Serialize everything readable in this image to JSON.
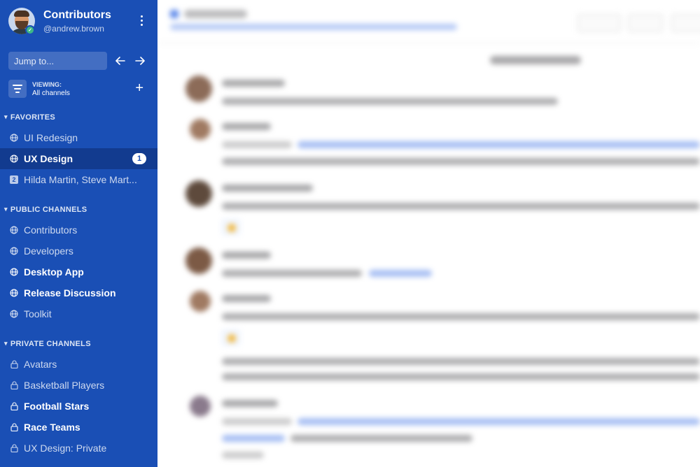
{
  "team": {
    "name": "Contributors",
    "username": "@andrew.brown"
  },
  "jump": {
    "placeholder": "Jump to..."
  },
  "viewing": {
    "label": "VIEWING:",
    "value": "All channels"
  },
  "sections": {
    "favorites": {
      "title": "FAVORITES",
      "items": [
        {
          "label": "UI Redesign",
          "icon": "globe-icon",
          "style": "normal"
        },
        {
          "label": "UX Design",
          "icon": "globe-icon",
          "style": "active",
          "badge": "1"
        },
        {
          "label": "Hilda Martin, Steve Mart...",
          "icon": "group-dm-icon",
          "dm_count": "2",
          "style": "normal"
        }
      ]
    },
    "public": {
      "title": "PUBLIC CHANNELS",
      "items": [
        {
          "label": "Contributors",
          "icon": "globe-icon",
          "style": "normal"
        },
        {
          "label": "Developers",
          "icon": "globe-icon",
          "style": "normal"
        },
        {
          "label": "Desktop App",
          "icon": "globe-icon",
          "style": "bold"
        },
        {
          "label": "Release Discussion",
          "icon": "globe-icon",
          "style": "bold"
        },
        {
          "label": "Toolkit",
          "icon": "globe-icon",
          "style": "normal"
        }
      ]
    },
    "private": {
      "title": "PRIVATE CHANNELS",
      "items": [
        {
          "label": "Avatars",
          "icon": "lock-icon",
          "style": "normal"
        },
        {
          "label": "Basketball Players",
          "icon": "lock-icon",
          "style": "normal"
        },
        {
          "label": "Football Stars",
          "icon": "lock-icon",
          "style": "bold"
        },
        {
          "label": "Race Teams",
          "icon": "lock-icon",
          "style": "bold"
        },
        {
          "label": "UX Design: Private",
          "icon": "lock-icon",
          "style": "normal"
        }
      ]
    }
  },
  "colors": {
    "sidebar": "#1a4fb5",
    "active_item": "#123b8f",
    "online": "#3db887",
    "link": "#5d89ea"
  }
}
